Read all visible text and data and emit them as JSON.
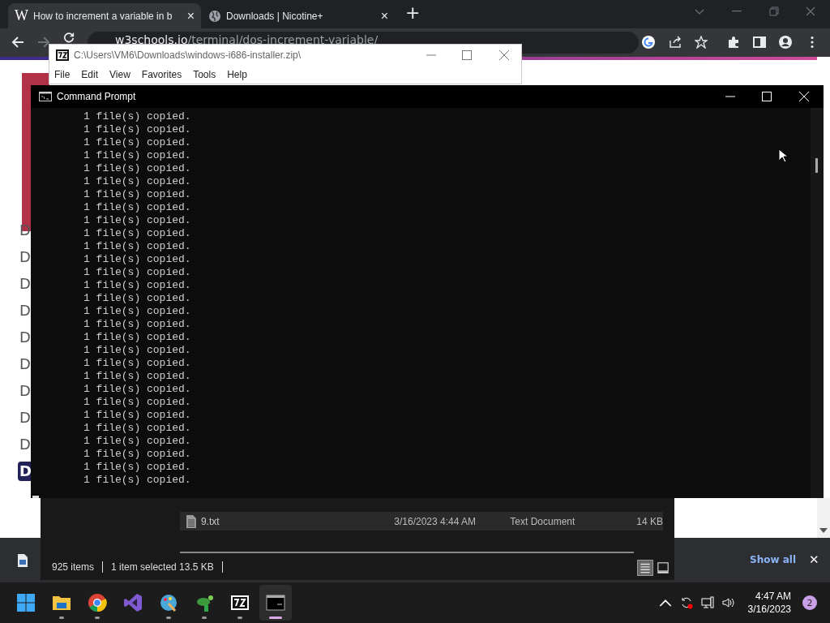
{
  "browser": {
    "tabs": [
      {
        "title": "How to increment a variable in b",
        "favicon": "W",
        "selected": true,
        "close": "×"
      },
      {
        "title": "Downloads | Nicotine+",
        "selected": false,
        "close": "×"
      }
    ],
    "new_tab": "+",
    "url": {
      "host": "w3schools.io",
      "path": "/terminal/dos-increment-variable/"
    },
    "page": {
      "sidebar_items": [
        {
          "label": "D",
          "selected": false
        },
        {
          "label": "D",
          "selected": false
        },
        {
          "label": "D",
          "selected": false
        },
        {
          "label": "D",
          "selected": false
        },
        {
          "label": "D",
          "selected": false
        },
        {
          "label": "D",
          "selected": false
        },
        {
          "label": "D",
          "selected": false
        },
        {
          "label": "D",
          "selected": false
        },
        {
          "label": "D",
          "selected": false
        },
        {
          "label": "D",
          "selected": true
        }
      ]
    },
    "downloads_bar": {
      "show_all": "Show all",
      "close": "✕"
    }
  },
  "archive_window": {
    "title": "C:\\Users\\VM6\\Downloads\\windows-i686-installer.zip\\",
    "menu": [
      "File",
      "Edit",
      "View",
      "Favorites",
      "Tools",
      "Help"
    ]
  },
  "explorer": {
    "rows": [
      {
        "name": "9.txt",
        "modified": "3/16/2023 4:44 AM",
        "type": "Text Document",
        "size": "14 KB"
      }
    ],
    "status": {
      "items": "925 items",
      "selection": "1 item selected  13.5 KB"
    },
    "views": [
      {
        "kind": "details",
        "selected": true
      },
      {
        "kind": "tiles",
        "selected": false
      }
    ]
  },
  "console": {
    "title": "Command Prompt",
    "lines": [
      "1 file(s) copied.",
      "1 file(s) copied.",
      "1 file(s) copied.",
      "1 file(s) copied.",
      "1 file(s) copied.",
      "1 file(s) copied.",
      "1 file(s) copied.",
      "1 file(s) copied.",
      "1 file(s) copied.",
      "1 file(s) copied.",
      "1 file(s) copied.",
      "1 file(s) copied.",
      "1 file(s) copied.",
      "1 file(s) copied.",
      "1 file(s) copied.",
      "1 file(s) copied.",
      "1 file(s) copied.",
      "1 file(s) copied.",
      "1 file(s) copied.",
      "1 file(s) copied.",
      "1 file(s) copied.",
      "1 file(s) copied.",
      "1 file(s) copied.",
      "1 file(s) copied.",
      "1 file(s) copied.",
      "1 file(s) copied.",
      "1 file(s) copied.",
      "1 file(s) copied.",
      "1 file(s) copied."
    ]
  },
  "taskbar": {
    "apps": [
      {
        "kind": "start",
        "running": false,
        "selected": false
      },
      {
        "kind": "folder",
        "running": true,
        "selected": false
      },
      {
        "kind": "chrome",
        "running": true,
        "selected": false
      },
      {
        "kind": "studio",
        "running": false,
        "selected": false
      },
      {
        "kind": "paint",
        "running": true,
        "selected": false
      },
      {
        "kind": "turtle",
        "running": true,
        "selected": false
      },
      {
        "kind": "archive",
        "running": true,
        "selected": false
      },
      {
        "kind": "terminal",
        "running": true,
        "selected": true
      }
    ],
    "time": "4:47 AM",
    "date": "3/16/2023",
    "notifications": "2"
  }
}
